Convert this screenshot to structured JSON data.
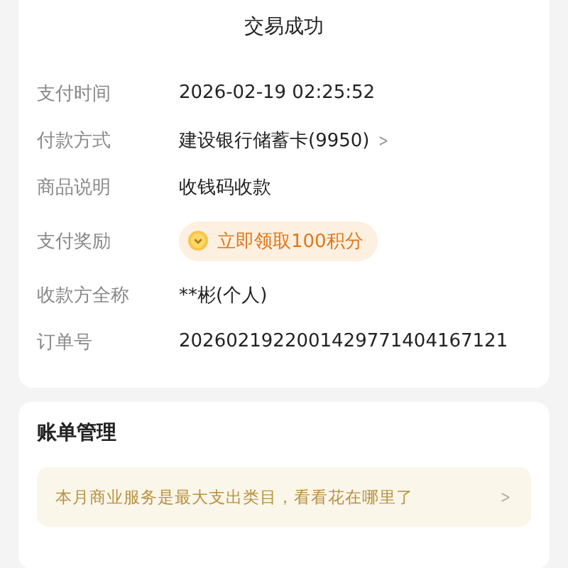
{
  "header": {
    "status": "交易成功"
  },
  "details": [
    {
      "kind": "text",
      "label": "支付时间",
      "value": "2026-02-19 02:25:52"
    },
    {
      "kind": "link",
      "label": "付款方式",
      "value": "建设银行储蓄卡(9950)",
      "arrow": ">"
    },
    {
      "kind": "text",
      "label": "商品说明",
      "value": "收钱码收款"
    },
    {
      "kind": "reward",
      "label": "支付奖励",
      "value": "立即领取100积分"
    },
    {
      "kind": "text",
      "label": "收款方全称",
      "value": "**彬(个人)"
    },
    {
      "kind": "text",
      "label": "订单号",
      "value": "2026021922001429771404167121"
    }
  ],
  "bill_management": {
    "title": "账单管理",
    "tip": "本月商业服务是最大支出类目，看看花在哪里了",
    "arrow": ">"
  }
}
